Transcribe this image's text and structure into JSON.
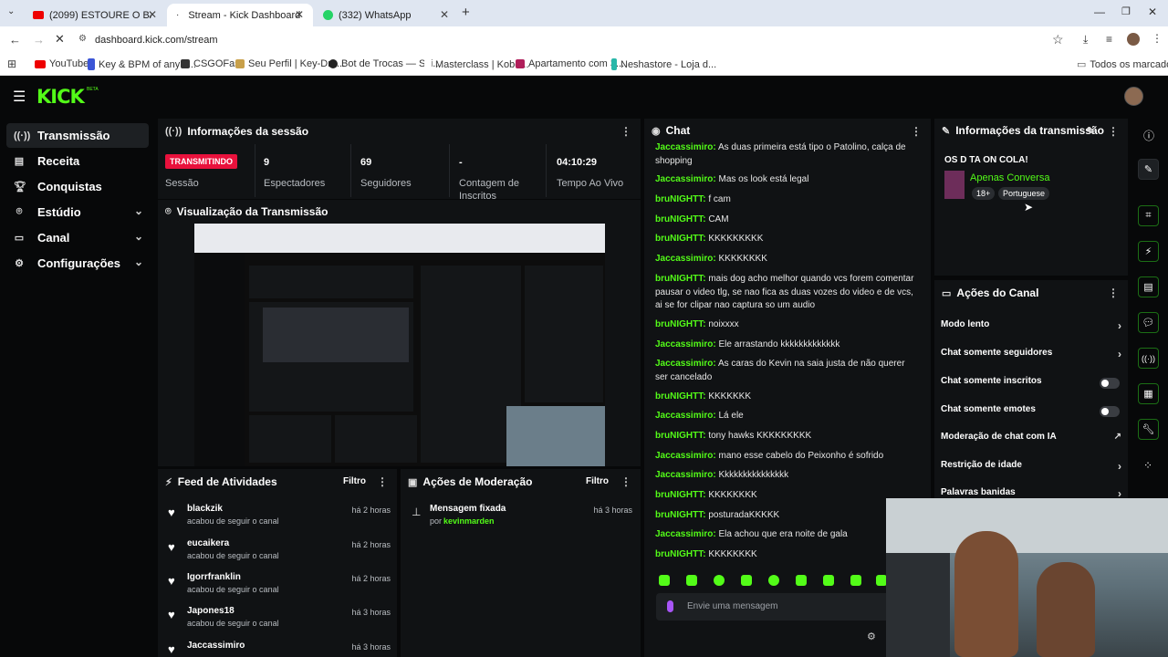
{
  "browser": {
    "tabs": [
      {
        "title": "(2099) ESTOURE O BALÃO OU E"
      },
      {
        "title": "Stream - Kick Dashboard"
      },
      {
        "title": "(332) WhatsApp"
      }
    ],
    "url": "dashboard.kick.com/stream",
    "bookmarks": [
      "YouTube",
      "Key & BPM of any s...",
      "CSGOFast",
      "Seu Perfil | Key-Dro...",
      "Bot de Trocas — Ski...",
      "Masterclass | Kobe...",
      "Apartamento com 3...",
      "Neshastore - Loja d..."
    ],
    "all_bookmarks": "Todos os marcadores"
  },
  "kick": {
    "logo": "KICK",
    "logo_sup": "BETA"
  },
  "sidebar": {
    "items": [
      {
        "label": "Transmissão",
        "icon": "broadcast-icon"
      },
      {
        "label": "Receita",
        "icon": "receipt-icon"
      },
      {
        "label": "Conquistas",
        "icon": "trophy-icon"
      },
      {
        "label": "Estúdio",
        "icon": "studio-icon"
      },
      {
        "label": "Canal",
        "icon": "channel-icon"
      },
      {
        "label": "Configurações",
        "icon": "gear-icon"
      }
    ]
  },
  "session": {
    "title": "Informações da sessão",
    "status_badge": "TRANSMITINDO",
    "status_label": "Sessão",
    "viewers_value": "9",
    "viewers_label": "Espectadores",
    "followers_value": "69",
    "followers_label": "Seguidores",
    "subs_value": "-",
    "subs_label": "Contagem de Inscritos",
    "uptime_value": "04:10:29",
    "uptime_label": "Tempo Ao Vivo"
  },
  "preview": {
    "title": "Visualização da Transmissão"
  },
  "feed": {
    "title": "Feed de Atividades",
    "filter": "Filtro",
    "items": [
      {
        "name": "blackzik",
        "sub": "acabou de seguir o canal",
        "time": "há 2 horas"
      },
      {
        "name": "eucaikera",
        "sub": "acabou de seguir o canal",
        "time": "há 2 horas"
      },
      {
        "name": "Igorrfranklin",
        "sub": "acabou de seguir o canal",
        "time": "há 2 horas"
      },
      {
        "name": "Japones18",
        "sub": "acabou de seguir o canal",
        "time": "há 3 horas"
      },
      {
        "name": "Jaccassimiro",
        "sub": "",
        "time": "há 3 horas"
      }
    ]
  },
  "moderation": {
    "title": "Ações de Moderação",
    "filter": "Filtro",
    "item_title": "Mensagem fixada",
    "item_by": "por",
    "item_user": "kevinmarden",
    "item_time": "há 3 horas"
  },
  "chat": {
    "title": "Chat",
    "placeholder": "Envie uma mensagem",
    "messages": [
      {
        "user": "Jaccassimiro:",
        "text": "As duas primeira está tipo o Patolino, calça de shopping"
      },
      {
        "user": "Jaccassimiro:",
        "text": "Mas os look está legal"
      },
      {
        "user": "bruNIGHTT:",
        "text": "f cam"
      },
      {
        "user": "bruNIGHTT:",
        "text": "CAM"
      },
      {
        "user": "bruNIGHTT:",
        "text": "KKKKKKKKK"
      },
      {
        "user": "Jaccassimiro:",
        "text": "KKKKKKKK"
      },
      {
        "user": "bruNIGHTT:",
        "text": "mais dog acho melhor quando vcs forem comentar pausar o video tlg, se nao fica as duas vozes do video e de vcs, ai se for clipar nao captura so um audio"
      },
      {
        "user": "bruNIGHTT:",
        "text": "noixxxx"
      },
      {
        "user": "Jaccassimiro:",
        "text": "Ele arrastando kkkkkkkkkkkkk"
      },
      {
        "user": "Jaccassimiro:",
        "text": "As caras do Kevin na saia justa de não querer ser cancelado"
      },
      {
        "user": "bruNIGHTT:",
        "text": "KKKKKKK"
      },
      {
        "user": "Jaccassimiro:",
        "text": "Lá ele"
      },
      {
        "user": "bruNIGHTT:",
        "text": "tony hawks KKKKKKKKK"
      },
      {
        "user": "Jaccassimiro:",
        "text": "mano esse cabelo do Peixonho é sofrido"
      },
      {
        "user": "Jaccassimiro:",
        "text": "Kkkkkkkkkkkkkkk"
      },
      {
        "user": "bruNIGHTT:",
        "text": "KKKKKKKK"
      },
      {
        "user": "bruNIGHTT:",
        "text": "posturadaKKKKK"
      },
      {
        "user": "Jaccassimiro:",
        "text": "Ela achou que era noite de gala"
      },
      {
        "user": "bruNIGHTT:",
        "text": "KKKKKKKK"
      }
    ]
  },
  "stream_info": {
    "title": "Informações da transmissão",
    "stream_title": "OS D TA ON COLA!",
    "category": "Apenas Conversa",
    "age_badge": "18+",
    "language_badge": "Portuguese"
  },
  "channel_actions": {
    "title": "Ações do Canal",
    "items": [
      {
        "label": "Modo lento"
      },
      {
        "label": "Chat somente seguidores"
      },
      {
        "label": "Chat somente inscritos"
      },
      {
        "label": "Chat somente emotes"
      },
      {
        "label": "Moderação de chat com IA"
      },
      {
        "label": "Restrição de idade"
      },
      {
        "label": "Palavras banidas"
      }
    ]
  },
  "colors": {
    "accent": "#53fc18",
    "live": "#e9113c",
    "panel": "#101214"
  }
}
